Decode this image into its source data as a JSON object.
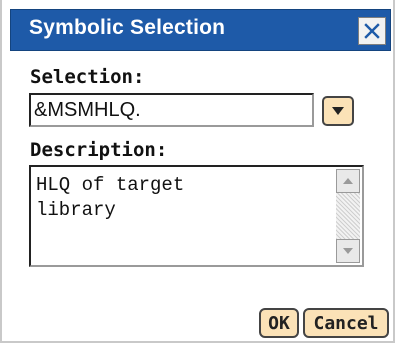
{
  "dialog": {
    "title": "Symbolic Selection",
    "close_icon": "close-icon"
  },
  "selection": {
    "label": "Selection:",
    "value": "&MSMHLQ.",
    "dropdown_icon": "chevron-down-icon"
  },
  "description": {
    "label": "Description:",
    "value": "HLQ of target\nlibrary",
    "scroll_up_icon": "triangle-up-icon",
    "scroll_down_icon": "triangle-down-icon"
  },
  "buttons": {
    "ok": "OK",
    "cancel": "Cancel"
  },
  "colors": {
    "titlebar": "#1e5aa8",
    "button_fill": "#fbe2b7"
  }
}
